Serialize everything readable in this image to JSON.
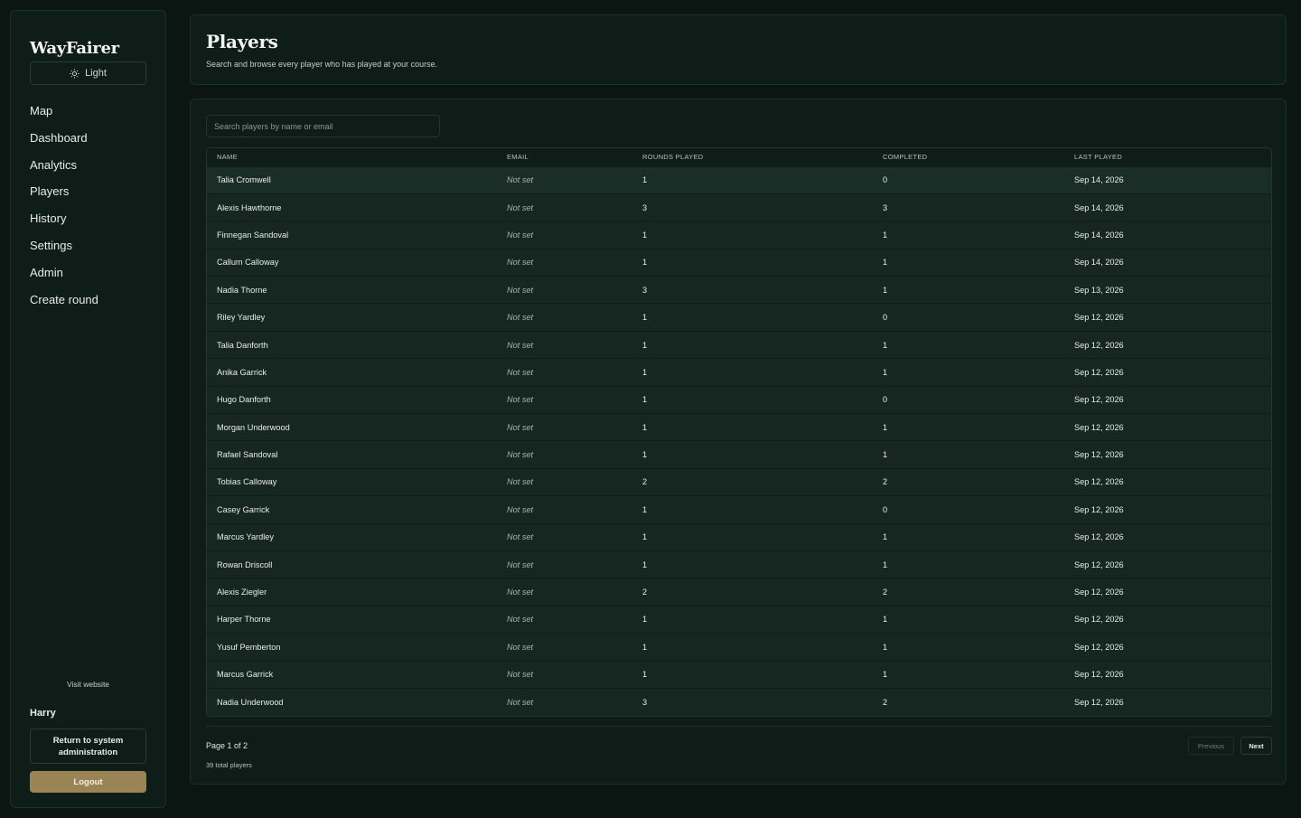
{
  "sidebar": {
    "brand": "WayFairer",
    "theme_label": "Light",
    "nav": [
      {
        "label": "Map"
      },
      {
        "label": "Dashboard"
      },
      {
        "label": "Analytics"
      },
      {
        "label": "Players"
      },
      {
        "label": "History"
      },
      {
        "label": "Settings"
      },
      {
        "label": "Admin"
      },
      {
        "label": "Create round"
      }
    ],
    "visit_website": "Visit website",
    "username": "Harry",
    "return_label": "Return to system administration",
    "logout_label": "Logout"
  },
  "header": {
    "title": "Players",
    "subtitle": "Search and browse every player who has played at your course."
  },
  "search": {
    "placeholder": "Search players by name or email"
  },
  "table": {
    "columns": [
      "NAME",
      "EMAIL",
      "ROUNDS PLAYED",
      "COMPLETED",
      "LAST PLAYED"
    ],
    "rows": [
      {
        "name": "Talia Cromwell",
        "email": "Not set",
        "rounds": "1",
        "completed": "0",
        "last": "Sep 14, 2026"
      },
      {
        "name": "Alexis Hawthorne",
        "email": "Not set",
        "rounds": "3",
        "completed": "3",
        "last": "Sep 14, 2026"
      },
      {
        "name": "Finnegan Sandoval",
        "email": "Not set",
        "rounds": "1",
        "completed": "1",
        "last": "Sep 14, 2026"
      },
      {
        "name": "Callum Calloway",
        "email": "Not set",
        "rounds": "1",
        "completed": "1",
        "last": "Sep 14, 2026"
      },
      {
        "name": "Nadia Thorne",
        "email": "Not set",
        "rounds": "3",
        "completed": "1",
        "last": "Sep 13, 2026"
      },
      {
        "name": "Riley Yardley",
        "email": "Not set",
        "rounds": "1",
        "completed": "0",
        "last": "Sep 12, 2026"
      },
      {
        "name": "Talia Danforth",
        "email": "Not set",
        "rounds": "1",
        "completed": "1",
        "last": "Sep 12, 2026"
      },
      {
        "name": "Anika Garrick",
        "email": "Not set",
        "rounds": "1",
        "completed": "1",
        "last": "Sep 12, 2026"
      },
      {
        "name": "Hugo Danforth",
        "email": "Not set",
        "rounds": "1",
        "completed": "0",
        "last": "Sep 12, 2026"
      },
      {
        "name": "Morgan Underwood",
        "email": "Not set",
        "rounds": "1",
        "completed": "1",
        "last": "Sep 12, 2026"
      },
      {
        "name": "Rafael Sandoval",
        "email": "Not set",
        "rounds": "1",
        "completed": "1",
        "last": "Sep 12, 2026"
      },
      {
        "name": "Tobias Calloway",
        "email": "Not set",
        "rounds": "2",
        "completed": "2",
        "last": "Sep 12, 2026"
      },
      {
        "name": "Casey Garrick",
        "email": "Not set",
        "rounds": "1",
        "completed": "0",
        "last": "Sep 12, 2026"
      },
      {
        "name": "Marcus Yardley",
        "email": "Not set",
        "rounds": "1",
        "completed": "1",
        "last": "Sep 12, 2026"
      },
      {
        "name": "Rowan Driscoll",
        "email": "Not set",
        "rounds": "1",
        "completed": "1",
        "last": "Sep 12, 2026"
      },
      {
        "name": "Alexis Ziegler",
        "email": "Not set",
        "rounds": "2",
        "completed": "2",
        "last": "Sep 12, 2026"
      },
      {
        "name": "Harper Thorne",
        "email": "Not set",
        "rounds": "1",
        "completed": "1",
        "last": "Sep 12, 2026"
      },
      {
        "name": "Yusuf Pemberton",
        "email": "Not set",
        "rounds": "1",
        "completed": "1",
        "last": "Sep 12, 2026"
      },
      {
        "name": "Marcus Garrick",
        "email": "Not set",
        "rounds": "1",
        "completed": "1",
        "last": "Sep 12, 2026"
      },
      {
        "name": "Nadia Underwood",
        "email": "Not set",
        "rounds": "3",
        "completed": "2",
        "last": "Sep 12, 2026"
      }
    ]
  },
  "pagination": {
    "page_info": "Page 1 of 2",
    "total": "39 total players",
    "prev_label": "Previous",
    "next_label": "Next"
  },
  "colors": {
    "background": "#0b1612",
    "card": "#0f1d18",
    "row": "#162722",
    "accent": "#9a8354"
  }
}
